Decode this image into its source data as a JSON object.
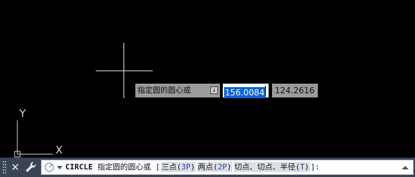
{
  "dynamic_input": {
    "prompt": "指定圆的圆心或",
    "x_value": "156.0084",
    "y_value": "124.2616"
  },
  "ucs": {
    "x_label": "X",
    "y_label": "Y"
  },
  "command_line": {
    "close_glyph": "✕",
    "command": "CIRCLE",
    "prompt": " 指定圆的圆心或 [",
    "options": [
      {
        "pre": "三点(",
        "key": "3P",
        "post": ")"
      },
      {
        "pre": "两点(",
        "key": "2P",
        "post": ")"
      },
      {
        "pre": "切点、切点、半径(",
        "key": "T",
        "post": ")"
      }
    ],
    "suffix": "]:"
  },
  "colors": {
    "canvas": "#000000",
    "crosshair": "#e6e6e6",
    "selection": "#0a63d8",
    "cmdbar": "#3b4452",
    "option_key": "#1a3fb0"
  }
}
